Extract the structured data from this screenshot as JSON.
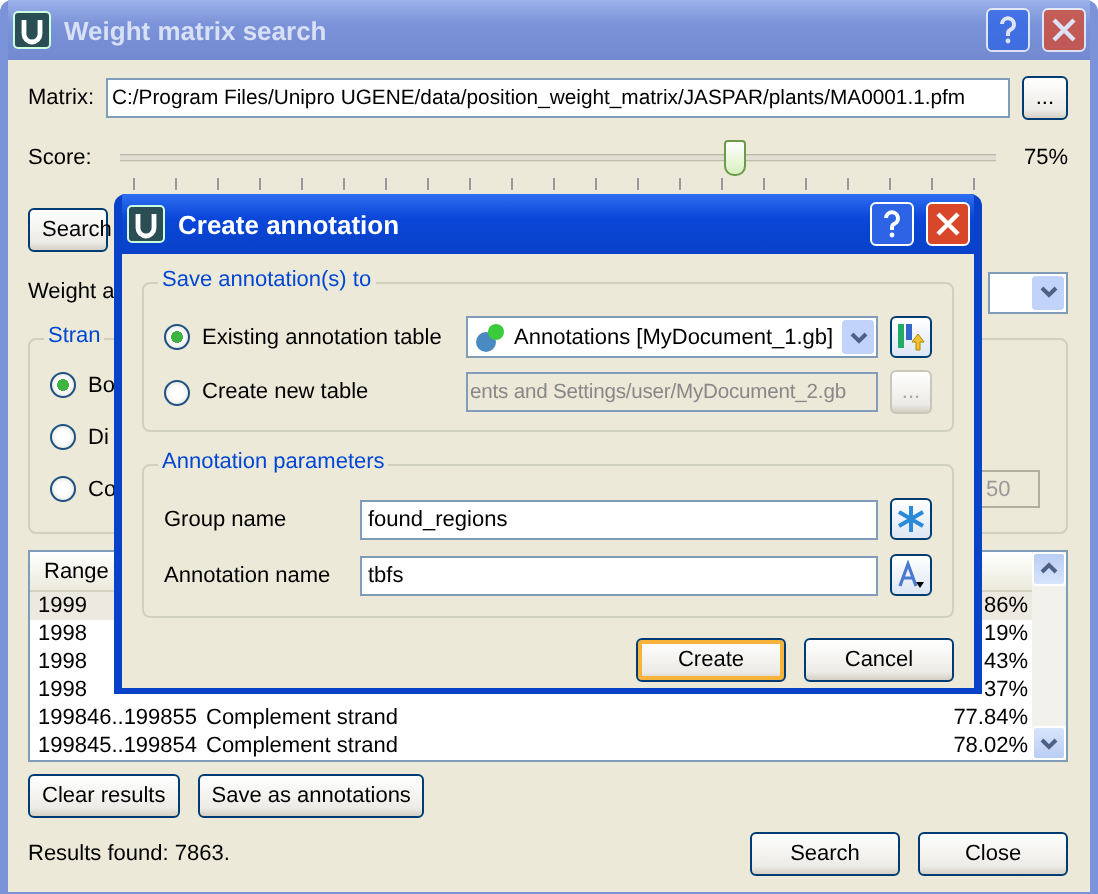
{
  "window": {
    "title": "Weight matrix search"
  },
  "matrix": {
    "label": "Matrix:",
    "value": "C:/Program Files/Unipro UGENE/data/position_weight_matrix/JASPAR/plants/MA0001.1.pfm",
    "browse": "..."
  },
  "score": {
    "label": "Score:",
    "level": 0.7,
    "reading": "75%"
  },
  "search_button": "Search",
  "weight_label": "Weight a",
  "strand": {
    "legend": "Stran",
    "options": [
      {
        "label": "Bo",
        "selected": true
      },
      {
        "label": "Di",
        "selected": false
      },
      {
        "label": "Co",
        "selected": false
      }
    ],
    "spin_value": "50"
  },
  "table": {
    "columns": [
      "Range"
    ],
    "rows": [
      {
        "range": "1999",
        "score": "86%",
        "selected": true
      },
      {
        "range": "1998",
        "score": "19%",
        "selected": false
      },
      {
        "range": "1998",
        "score": "43%",
        "selected": false
      },
      {
        "range": "1998",
        "score": "37%",
        "selected": false
      },
      {
        "range": "199846..199855",
        "strand": "Complement strand",
        "score": "77.84%",
        "selected": false
      },
      {
        "range": "199845..199854",
        "strand": "Complement strand",
        "score": "78.02%",
        "selected": false
      }
    ]
  },
  "actions": [
    "Clear results",
    "Save as annotations"
  ],
  "status": "Results found: 7863.",
  "footer_buttons": [
    "Search",
    "Close"
  ],
  "dialog": {
    "title": "Create annotation",
    "save_group": {
      "legend": "Save annotation(s) to",
      "options": [
        {
          "label": "Existing annotation table",
          "selected": true,
          "value": "Annotations [MyDocument_1.gb]"
        },
        {
          "label": "Create new table",
          "selected": false,
          "value": "ents and Settings/user/MyDocument_2.gb",
          "browse": "..."
        }
      ]
    },
    "params": {
      "legend": "Annotation parameters",
      "fields": [
        {
          "label": "Group name",
          "value": "found_regions"
        },
        {
          "label": "Annotation name",
          "value": "tbfs"
        }
      ]
    },
    "buttons": [
      {
        "label": "Create",
        "focused": true
      },
      {
        "label": "Cancel",
        "focused": false
      }
    ]
  }
}
